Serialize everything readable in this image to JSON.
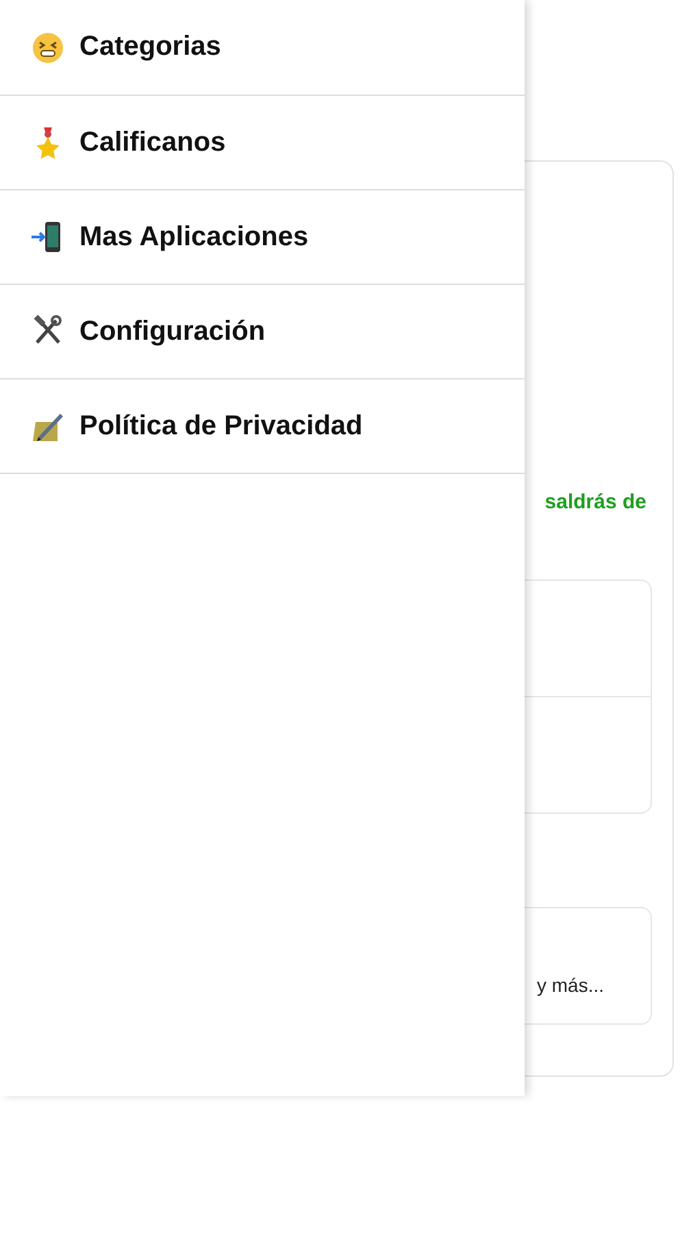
{
  "page": {
    "notice": "saldrás de",
    "card_text": "y más..."
  },
  "drawer": {
    "items": [
      {
        "label": "Categorias"
      },
      {
        "label": "Calificanos"
      },
      {
        "label": "Mas Aplicaciones"
      },
      {
        "label": "Configuración"
      },
      {
        "label": "Política de Privacidad"
      }
    ]
  }
}
